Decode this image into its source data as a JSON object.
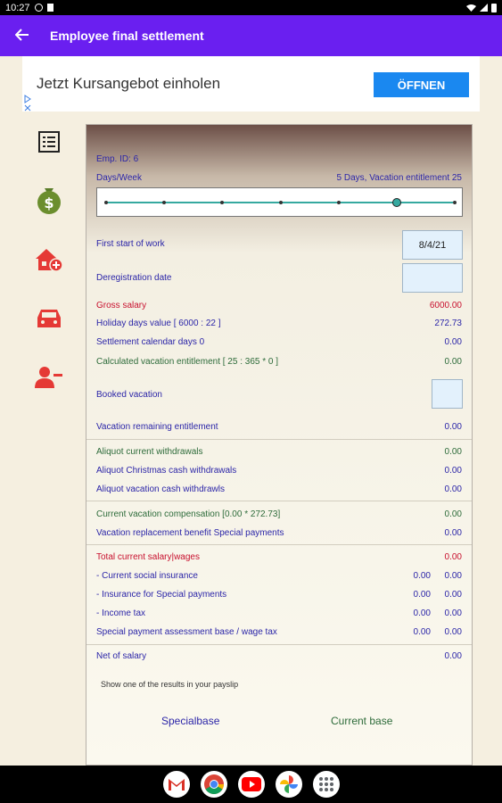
{
  "status_bar": {
    "time": "10:27"
  },
  "app_bar": {
    "back_icon": "arrow-left-icon",
    "title": "Employee final settlement"
  },
  "ad": {
    "text": "Jetzt Kursangebot einholen",
    "button_label": "ÖFFNEN"
  },
  "sidebar": {
    "items": [
      {
        "icon": "list-icon"
      },
      {
        "icon": "money-bag-icon"
      },
      {
        "icon": "house-add-icon"
      },
      {
        "icon": "car-icon"
      },
      {
        "icon": "person-remove-icon"
      }
    ]
  },
  "settlement": {
    "emp_id": "Emp. ID: 6",
    "days_week_label": "Days/Week",
    "days_week_value": "5 Days, Vacation entitlement  25",
    "days_week_selected": 6,
    "days_week_steps": 7,
    "first_start_label": "First start of work",
    "first_start_value": "8/4/21",
    "deregistration_label": "Deregistration date",
    "deregistration_value": "",
    "gross_salary_label": "Gross salary",
    "gross_salary_value": "6000.00",
    "holiday_value_label": "Holiday days value [ 6000 : 22 ]",
    "holiday_value_value": "272.73",
    "settlement_days_label": "Settlement calendar days 0",
    "settlement_days_value": "0.00",
    "calc_vacation_label": "Calculated vacation entitlement [ 25 : 365 * 0 ]",
    "calc_vacation_value": "0.00",
    "booked_vacation_label": "Booked vacation",
    "booked_vacation_value": "",
    "remaining_label": "Vacation remaining entitlement",
    "remaining_value": "0.00",
    "aliquot_current_label": "Aliquot current withdrawals",
    "aliquot_current_value": "0.00",
    "aliquot_christmas_label": "Aliquot Christmas cash withdrawals",
    "aliquot_christmas_value": "0.00",
    "aliquot_vacation_label": "Aliquot vacation cash withdrawls",
    "aliquot_vacation_value": "0.00",
    "current_comp_label": "Current vacation compensation [0.00 * 272.73]",
    "current_comp_value": "0.00",
    "replacement_label": "Vacation replacement benefit Special payments",
    "replacement_value": "0.00",
    "total_label": "Total current salary|wages",
    "total_value": "0.00",
    "social_label": "- Current social insurance",
    "social_v1": "0.00",
    "social_v2": "0.00",
    "insurance_special_label": "- Insurance for Special payments",
    "insurance_special_v1": "0.00",
    "insurance_special_v2": "0.00",
    "income_tax_label": "- Income tax",
    "income_tax_v1": "0.00",
    "income_tax_v2": "0.00",
    "special_base_label": "Special payment assessment base / wage tax",
    "special_base_v1": "0.00",
    "special_base_v2": "0.00",
    "net_label": "Net of salary",
    "net_value": "0.00",
    "payslip_hint": "Show one of the results in your payslip",
    "specialbase_button": "Specialbase",
    "currentbase_button": "Current base"
  },
  "nav_apps": [
    {
      "icon": "gmail-icon"
    },
    {
      "icon": "chrome-icon"
    },
    {
      "icon": "youtube-icon"
    },
    {
      "icon": "photos-icon"
    },
    {
      "icon": "app-drawer-icon"
    }
  ],
  "colors": {
    "app_bar": "#6a1ff0",
    "label_blue": "#2b25a8",
    "label_red": "#c8102e",
    "label_green": "#2d6b3a",
    "ad_button": "#1a88f0",
    "slider": "#36a9a0"
  }
}
